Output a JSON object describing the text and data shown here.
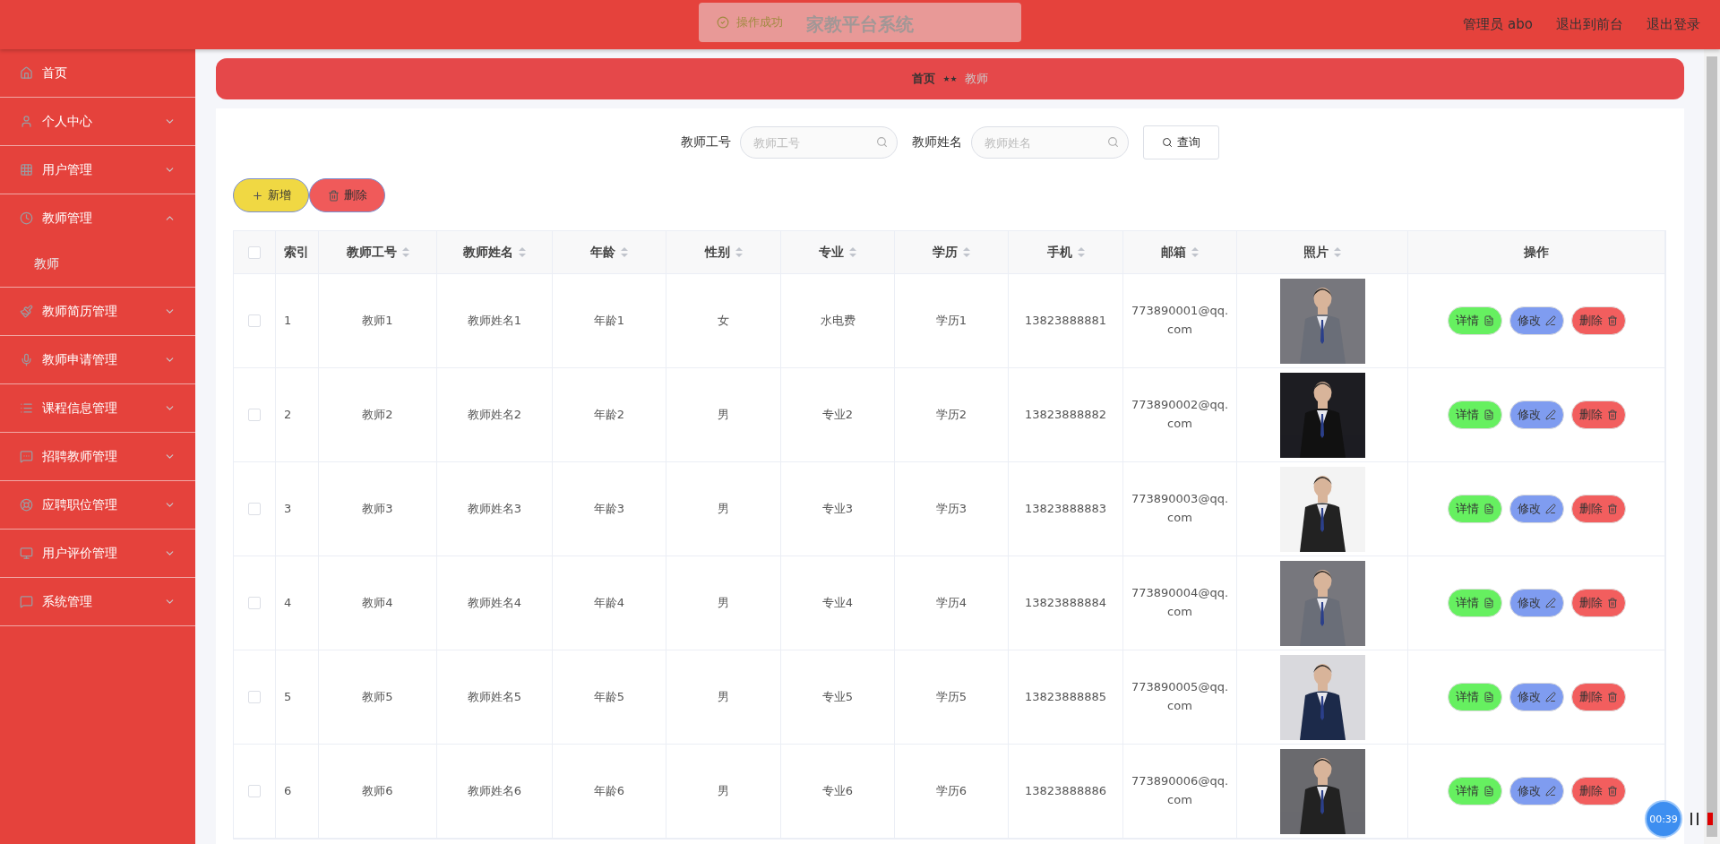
{
  "header": {
    "title": "家教平台系统",
    "links": [
      "管理员 abo",
      "退出到前台",
      "退出登录"
    ]
  },
  "toast": {
    "message": "操作成功"
  },
  "sidebar": {
    "items": [
      {
        "label": "首页"
      },
      {
        "label": "个人中心",
        "expanded": false
      },
      {
        "label": "用户管理",
        "expanded": false
      },
      {
        "label": "教师管理",
        "expanded": true,
        "children": [
          {
            "label": "教师"
          }
        ]
      },
      {
        "label": "教师简历管理",
        "expanded": false
      },
      {
        "label": "教师申请管理",
        "expanded": false
      },
      {
        "label": "课程信息管理",
        "expanded": false
      },
      {
        "label": "招聘教师管理",
        "expanded": false
      },
      {
        "label": "应聘职位管理",
        "expanded": false
      },
      {
        "label": "用户评价管理",
        "expanded": false
      },
      {
        "label": "系统管理",
        "expanded": false
      }
    ]
  },
  "breadcrumb": {
    "items": [
      "首页",
      "教师"
    ],
    "separator": "★★"
  },
  "search": {
    "fields": [
      {
        "label": "教师工号",
        "placeholder": "教师工号"
      },
      {
        "label": "教师姓名",
        "placeholder": "教师姓名"
      }
    ],
    "button": "查询"
  },
  "actions": [
    {
      "kind": "add",
      "label": "新增"
    },
    {
      "kind": "delete",
      "label": "删除"
    }
  ],
  "table": {
    "all_checked": false,
    "columns": [
      {
        "label": "索引",
        "sortable": false
      },
      {
        "label": "教师工号",
        "sortable": true
      },
      {
        "label": "教师姓名",
        "sortable": true
      },
      {
        "label": "年龄",
        "sortable": true
      },
      {
        "label": "性别",
        "sortable": true
      },
      {
        "label": "专业",
        "sortable": true
      },
      {
        "label": "学历",
        "sortable": true
      },
      {
        "label": "手机",
        "sortable": true
      },
      {
        "label": "邮箱",
        "sortable": true
      },
      {
        "label": "照片",
        "sortable": true
      },
      {
        "label": "操作",
        "sortable": false
      }
    ],
    "rows": [
      {
        "checked": false,
        "cells": [
          "1",
          "教师1",
          "教师姓名1",
          "年龄1",
          "女",
          "水电费",
          "学历1",
          "13823888881",
          "773890001@qq.com"
        ],
        "buttons": [
          {
            "kind": "detail",
            "label": "详情"
          },
          {
            "kind": "edit",
            "label": "修改"
          },
          {
            "kind": "delete",
            "label": "删除"
          }
        ]
      },
      {
        "checked": false,
        "cells": [
          "2",
          "教师2",
          "教师姓名2",
          "年龄2",
          "男",
          "专业2",
          "学历2",
          "13823888882",
          "773890002@qq.com"
        ],
        "buttons": [
          {
            "kind": "detail",
            "label": "详情"
          },
          {
            "kind": "edit",
            "label": "修改"
          },
          {
            "kind": "delete",
            "label": "删除"
          }
        ]
      },
      {
        "checked": false,
        "cells": [
          "3",
          "教师3",
          "教师姓名3",
          "年龄3",
          "男",
          "专业3",
          "学历3",
          "13823888883",
          "773890003@qq.com"
        ],
        "buttons": [
          {
            "kind": "detail",
            "label": "详情"
          },
          {
            "kind": "edit",
            "label": "修改"
          },
          {
            "kind": "delete",
            "label": "删除"
          }
        ]
      },
      {
        "checked": false,
        "cells": [
          "4",
          "教师4",
          "教师姓名4",
          "年龄4",
          "男",
          "专业4",
          "学历4",
          "13823888884",
          "773890004@qq.com"
        ],
        "buttons": [
          {
            "kind": "detail",
            "label": "详情"
          },
          {
            "kind": "edit",
            "label": "修改"
          },
          {
            "kind": "delete",
            "label": "删除"
          }
        ]
      },
      {
        "checked": false,
        "cells": [
          "5",
          "教师5",
          "教师姓名5",
          "年龄5",
          "男",
          "专业5",
          "学历5",
          "13823888885",
          "773890005@qq.com"
        ],
        "buttons": [
          {
            "kind": "detail",
            "label": "详情"
          },
          {
            "kind": "edit",
            "label": "修改"
          },
          {
            "kind": "delete",
            "label": "删除"
          }
        ]
      },
      {
        "checked": false,
        "cells": [
          "6",
          "教师6",
          "教师姓名6",
          "年龄6",
          "男",
          "专业6",
          "学历6",
          "13823888886",
          "773890006@qq.com"
        ],
        "buttons": [
          {
            "kind": "detail",
            "label": "详情"
          },
          {
            "kind": "edit",
            "label": "修改"
          },
          {
            "kind": "delete",
            "label": "删除"
          }
        ]
      }
    ]
  },
  "recorder": {
    "time": "00:39"
  }
}
